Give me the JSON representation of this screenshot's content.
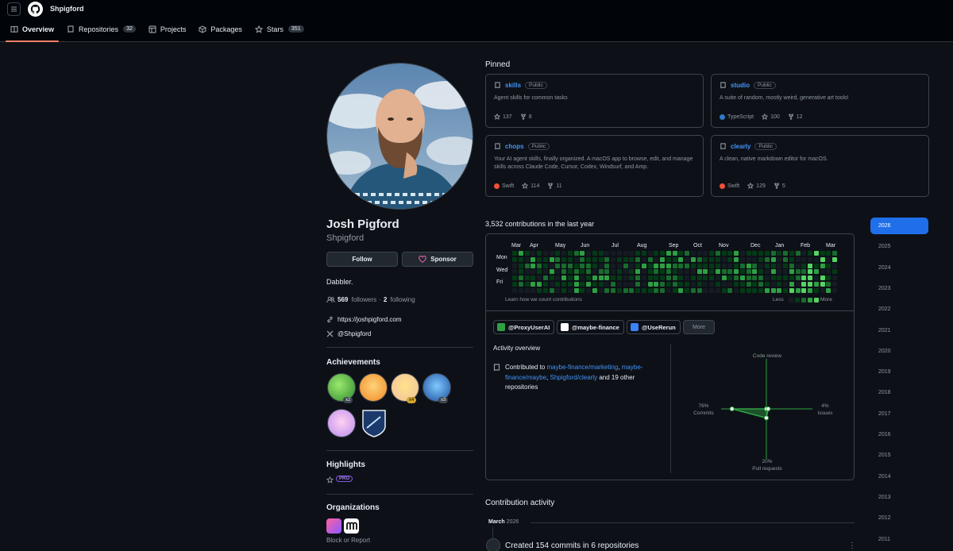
{
  "header": {
    "username": "Shpigford",
    "tabs": [
      {
        "label": "Overview",
        "icon": "book-icon",
        "active": true
      },
      {
        "label": "Repositories",
        "icon": "repo-icon",
        "count": "32"
      },
      {
        "label": "Projects",
        "icon": "table-icon"
      },
      {
        "label": "Packages",
        "icon": "package-icon"
      },
      {
        "label": "Stars",
        "icon": "star-icon",
        "count": "351"
      }
    ]
  },
  "profile": {
    "name": "Josh Pigford",
    "login": "Shpigford",
    "follow_label": "Follow",
    "sponsor_label": "Sponsor",
    "bio": "Dabbler.",
    "followers_count": "569",
    "followers_label": "followers",
    "separator": "·",
    "following_count": "2",
    "following_label": "following",
    "website": "https://joshpigford.com",
    "twitter": "@Shpigford"
  },
  "sidebar": {
    "achievements_title": "Achievements",
    "achievements": [
      {
        "name": "pair-extraordinaire",
        "count": "x2"
      },
      {
        "name": "starstruck",
        "count": ""
      },
      {
        "name": "galaxy-brain",
        "count": "x4"
      },
      {
        "name": "pull-shark",
        "count": "x3"
      },
      {
        "name": "yolo",
        "count": ""
      },
      {
        "name": "arctic-code-vault",
        "count": ""
      }
    ],
    "highlights_title": "Highlights",
    "pro_label": "PRO",
    "organizations_title": "Organizations",
    "block_report": "Block or Report"
  },
  "pinned": {
    "title": "Pinned",
    "items": [
      {
        "name": "skills",
        "visibility": "Public",
        "description": "Agent skills for common tasks",
        "language": "",
        "language_color": "",
        "stars": "137",
        "forks": "8"
      },
      {
        "name": "studio",
        "visibility": "Public",
        "description": "A suite of random, mostly weird, generative art tools!",
        "language": "TypeScript",
        "language_color": "#3178c6",
        "stars": "100",
        "forks": "12"
      },
      {
        "name": "chops",
        "visibility": "Public",
        "description": "Your AI agent skills, finally organized. A macOS app to browse, edit, and manage skills across Claude Code, Cursor, Codex, Windsurf, and Amp.",
        "language": "Swift",
        "language_color": "#f05138",
        "stars": "114",
        "forks": "11"
      },
      {
        "name": "clearly",
        "visibility": "Public",
        "description": "A clean, native markdown editor for macOS.",
        "language": "Swift",
        "language_color": "#f05138",
        "stars": "129",
        "forks": "5"
      }
    ]
  },
  "contributions": {
    "title": "3,532 contributions in the last year",
    "months": [
      "Mar",
      "Apr",
      "May",
      "Jun",
      "Jul",
      "Aug",
      "Sep",
      "Oct",
      "Nov",
      "Dec",
      "Jan",
      "Feb",
      "Mar"
    ],
    "days": [
      "Mon",
      "Wed",
      "Fri"
    ],
    "learn_link": "Learn how we count contributions",
    "less": "Less",
    "more": "More",
    "colors": [
      "#151b23",
      "#033a16",
      "#196c2e",
      "#2ea043",
      "#56d364"
    ]
  },
  "activity": {
    "orgs": [
      {
        "label": "@ProxyUserAI",
        "color": "#2ea043"
      },
      {
        "label": "@maybe-finance",
        "color": "#ffffff"
      },
      {
        "label": "@UseRerun",
        "color": "#3b82f6"
      }
    ],
    "more_label": "More",
    "overview_title": "Activity overview",
    "contributed_prefix": "Contributed to",
    "repo1": "maybe-finance/marketing",
    "repo2": "maybe-finance/maybe",
    "repo3": "Shpigford/clearly",
    "suffix": "and 19 other repositories",
    "radar": {
      "code_review_label": "Code review",
      "issues_pct": "4%",
      "issues_label": "Issues",
      "commits_pct": "76%",
      "commits_label": "Commits",
      "prs_pct": "20%",
      "prs_label": "Pull requests",
      "code_review_value": 0,
      "issues_value": 4,
      "commits_value": 76,
      "prs_value": 20
    }
  },
  "contribution_activity": {
    "title": "Contribution activity",
    "month": "March",
    "year": "2026",
    "item": "Created 154 commits in 6 repositories"
  },
  "years": [
    "2026",
    "2025",
    "2024",
    "2023",
    "2022",
    "2021",
    "2020",
    "2019",
    "2018",
    "2017",
    "2016",
    "2015",
    "2014",
    "2013",
    "2012",
    "2011"
  ]
}
